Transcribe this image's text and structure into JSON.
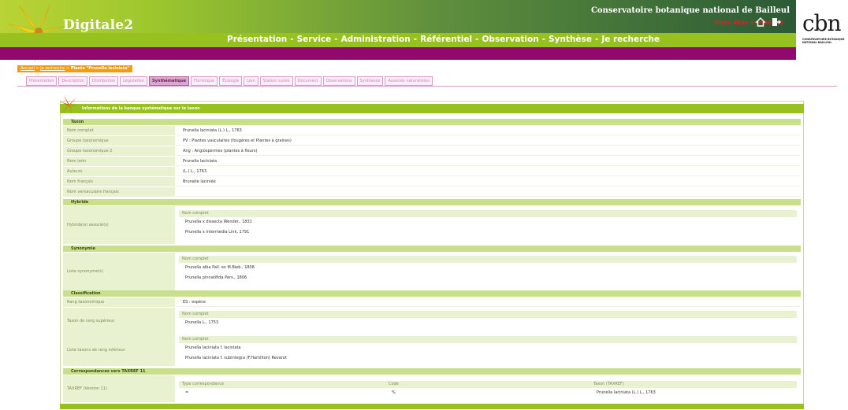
{
  "app": {
    "title": "Digitale2",
    "org": "Conservatoire botanique national de Bailleul",
    "user_status": "Vous êtes connecté"
  },
  "nav": {
    "items": [
      "Présentation",
      "Service",
      "Administration",
      "Référentiel",
      "Observation",
      "Synthèse",
      "Je recherche"
    ],
    "separator": "-"
  },
  "logo": {
    "text": "cbn",
    "subtitle": "CONSERVATOIRE BOTANIQUE NATIONAL BAILLEUL"
  },
  "breadcrumb": {
    "home": "Accueil",
    "search": "Je recherche",
    "current": "Plante \"Prunella laciniata\"",
    "separator": ">"
  },
  "tabs": [
    "Présentation",
    "Description",
    "Distribution",
    "Législation",
    "Synthématique",
    "Floristique",
    "Écologie",
    "Lien",
    "Station suivie",
    "Document",
    "Observations",
    "Synthèses",
    "Associés naturalistes"
  ],
  "active_tab": 4,
  "panel": {
    "title": "Informations de la banque systématique sur le taxon",
    "taxon": {
      "section": "Taxon",
      "rows": [
        {
          "label": "Nom complet",
          "value": "Prunella laciniata (L.) L., 1763"
        },
        {
          "label": "Groupe taxonomique",
          "value": "PV : Plantes vasculaires (fougères et Plantes à graines)"
        },
        {
          "label": "Groupe taxonomique 2",
          "value": "Ang : Angiospermes (plantes à fleurs)"
        },
        {
          "label": "Nom latin",
          "value": "Prunella laciniata"
        },
        {
          "label": "Auteurs",
          "value": "(L.) L., 1763"
        },
        {
          "label": "Nom français",
          "value": "Brunelle laciniée"
        },
        {
          "label": "Nom vernaculaire français",
          "value": ""
        }
      ]
    },
    "hybride": {
      "section": "Hybride",
      "label": "Hybride(s) associé(s)",
      "column": "Nom complet",
      "items": [
        "Prunella x dissecta Wender., 1831",
        "Prunella x intermedia Link, 1791"
      ]
    },
    "synonymie": {
      "section": "Synonymie",
      "label": "Liste synonyme(s)",
      "column": "Nom complet",
      "items": [
        "Prunella alba Pall. ex M.Bieb., 1808",
        "Prunella pinnatifida Pers., 1806"
      ]
    },
    "classification": {
      "section": "Classification",
      "rang_label": "Rang taxonomique",
      "rang_value": "ES : espèce",
      "sup_label": "Taxon de rang supérieur",
      "sup_column": "Nom complet",
      "sup_items": [
        "Prunella L., 1753"
      ],
      "inf_label": "Liste taxons de rang inférieur",
      "inf_column": "Nom complet",
      "inf_items": [
        "Prunella laciniata f. laciniata",
        "Prunella laciniata f. subintegra (F.Hamilton) Revarot"
      ]
    },
    "taxref": {
      "section": "Correspondances vers TAXREF 11",
      "label": "TAXREF (Version 11)",
      "columns": [
        "Type correspondance",
        "Code",
        "Taxon (TAXREF)"
      ],
      "row": [
        "=",
        "%",
        "Prunella laciniata (L.) L., 1763"
      ]
    }
  },
  "colors": {
    "green": "#97c11f",
    "purple": "#92096d",
    "orange": "#f39c12",
    "tab_pink": "#d99bc9"
  }
}
